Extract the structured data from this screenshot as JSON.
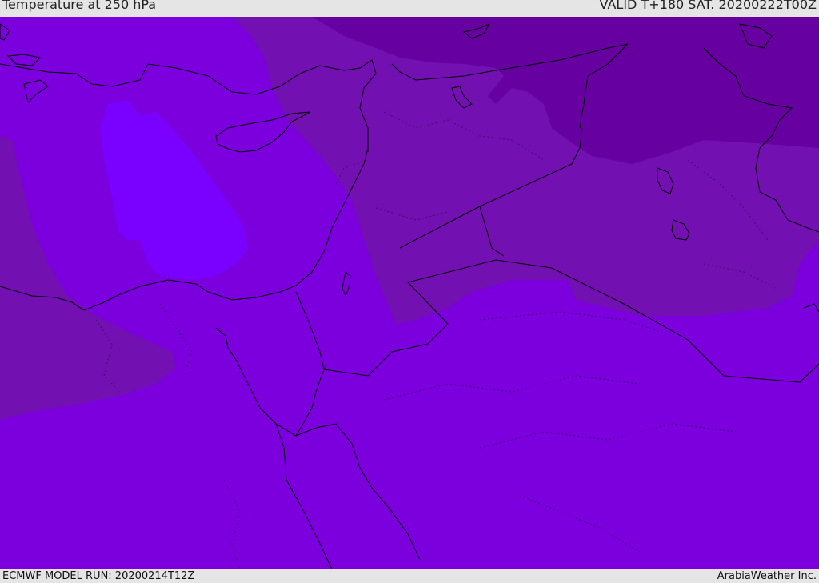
{
  "header": {
    "title": "Temperature at 250 hPa",
    "valid": "VALID T+180 SAT. 20200222T00Z"
  },
  "footer": {
    "model_run": "ECMWF MODEL RUN: 20200214T12Z",
    "credit": "ArabiaWeather Inc."
  },
  "colors": {
    "base": "#7b00dd",
    "warm": "#7a00ff",
    "cool": "#7210b2",
    "coldest": "#6600a0",
    "coast": "#000000"
  }
}
